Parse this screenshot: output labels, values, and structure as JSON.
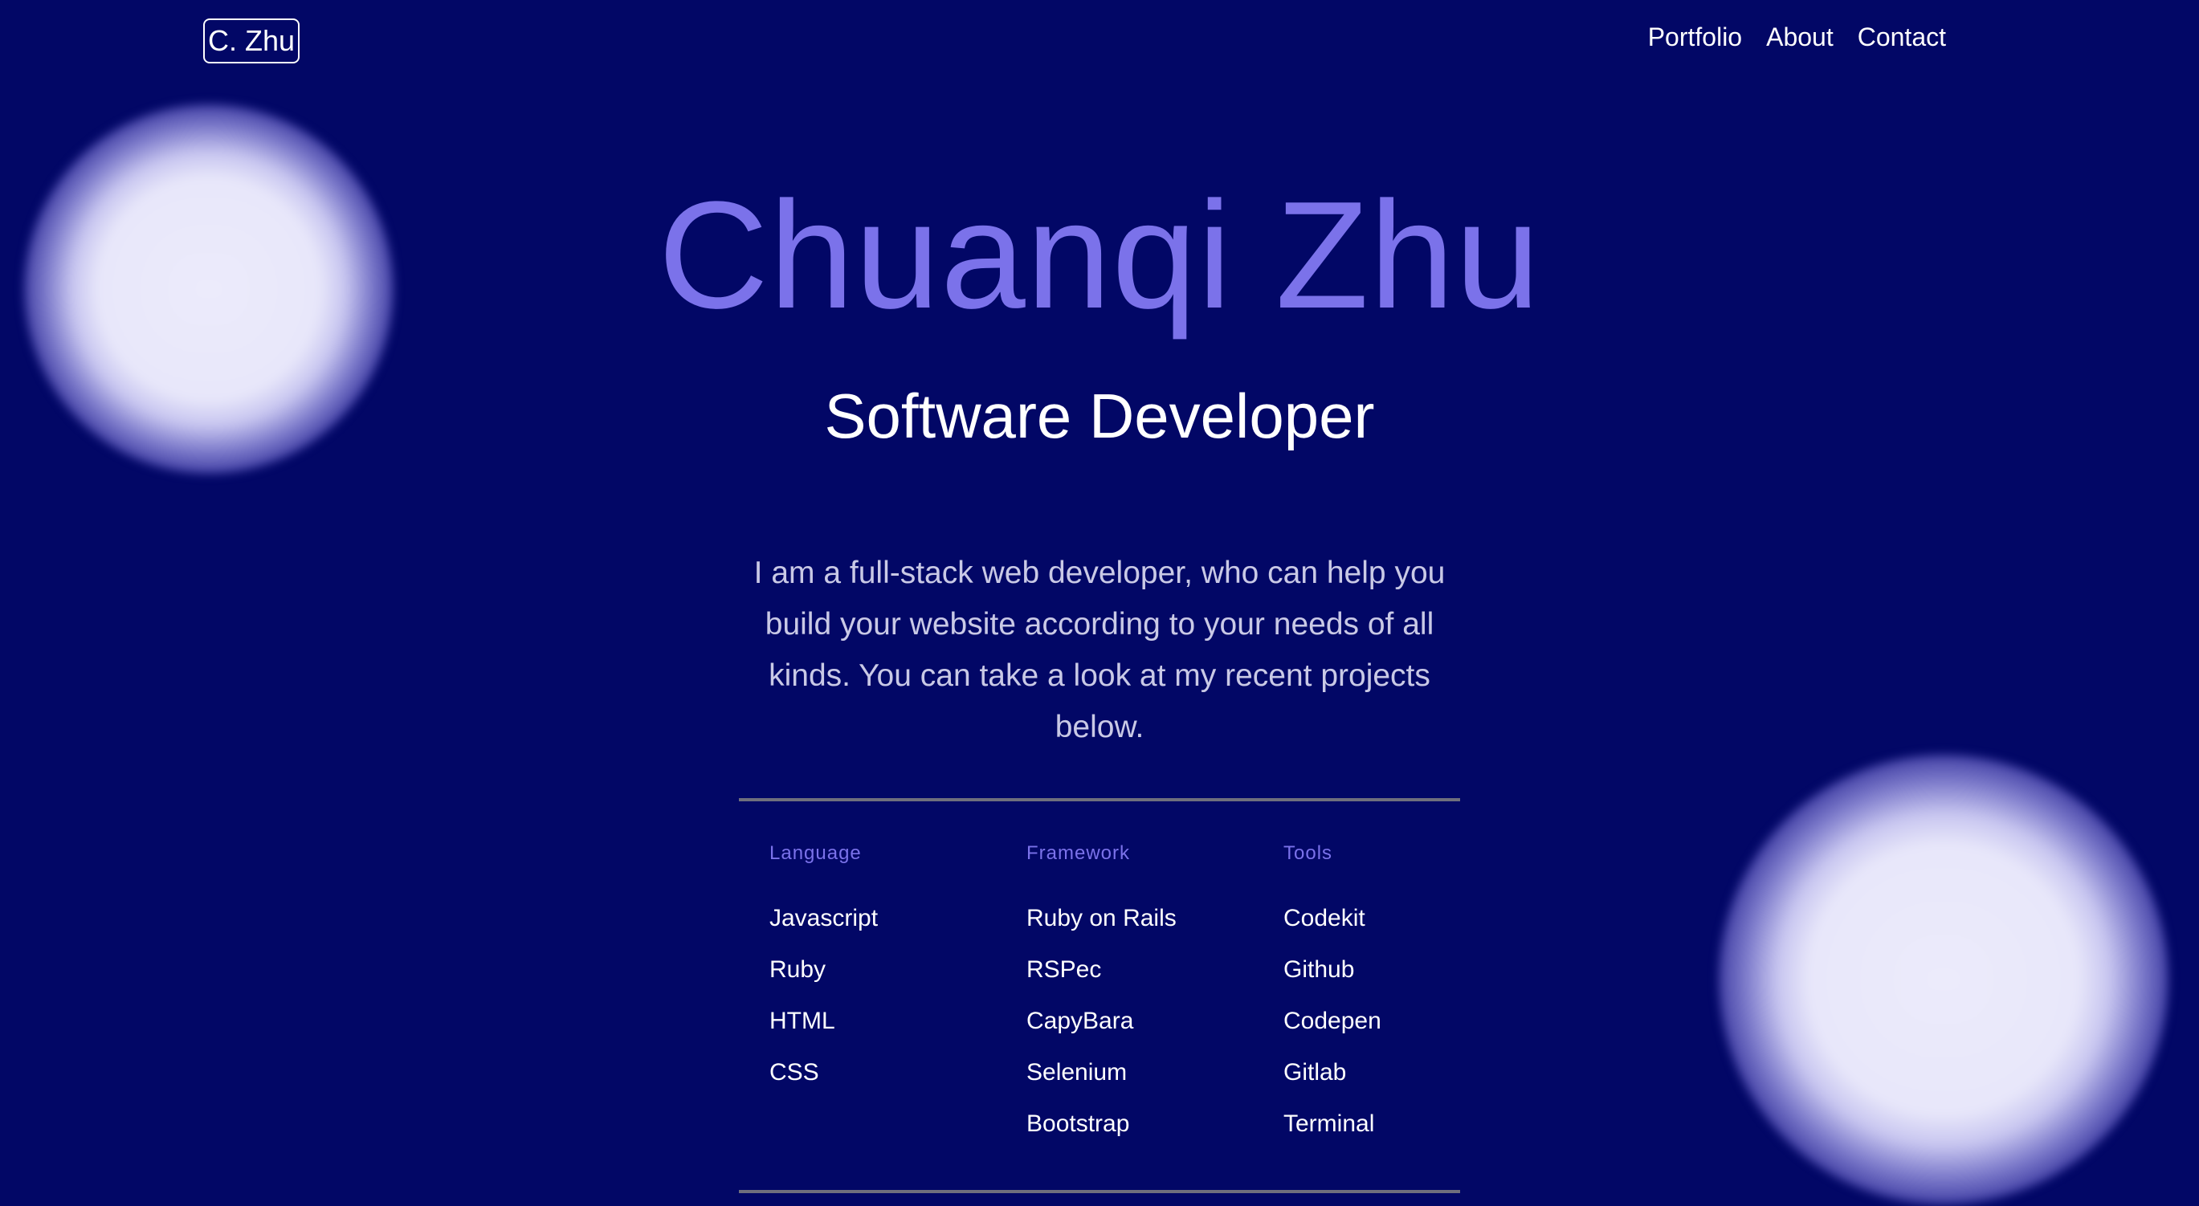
{
  "header": {
    "logo": "C. Zhu",
    "nav": [
      "Portfolio",
      "About",
      "Contact"
    ]
  },
  "hero": {
    "name": "Chuanqi Zhu",
    "role": "Software Developer",
    "intro": "I am a full-stack web developer, who can help you build your website according to your needs of all kinds. You can take a look at my recent projects below."
  },
  "skills": [
    {
      "heading": "Language",
      "items": [
        "Javascript",
        "Ruby",
        "HTML",
        "CSS"
      ]
    },
    {
      "heading": "Framework",
      "items": [
        "Ruby on Rails",
        "RSPec",
        "CapyBara",
        "Selenium",
        "Bootstrap"
      ]
    },
    {
      "heading": "Tools",
      "items": [
        "Codekit",
        "Github",
        "Codepen",
        "Gitlab",
        "Terminal"
      ]
    }
  ],
  "colors": {
    "background": "#020766",
    "accent": "#7b72ea",
    "text": "#ffffff",
    "muted_text": "#c9c9e6",
    "divider": "#6f6f7d"
  }
}
